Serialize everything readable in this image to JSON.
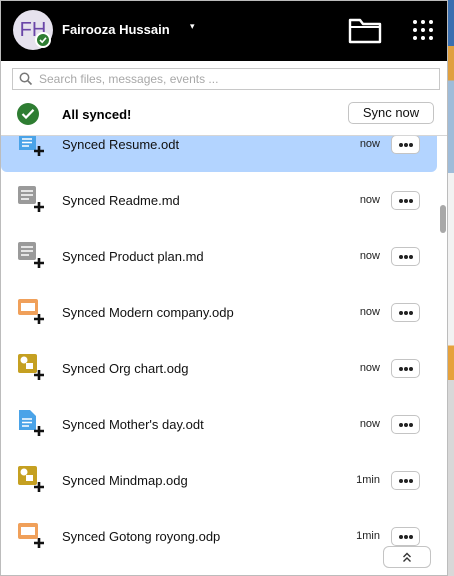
{
  "header": {
    "avatar_initials": "FH",
    "user_name": "Fairooza Hussain",
    "account_menu_caret": "▾",
    "icons": [
      "folder-icon",
      "apps-grid-icon"
    ]
  },
  "search": {
    "placeholder": "Search files, messages, events ..."
  },
  "sync": {
    "status": "All synced!",
    "button_label": "Sync now"
  },
  "activity": [
    {
      "name": "Synced Resume.odt",
      "time": "now",
      "icon": "document-icon",
      "color": "#4aa3e8",
      "selected": true
    },
    {
      "name": "Synced Readme.md",
      "time": "now",
      "icon": "text-file-icon",
      "color": "#9a9a9a"
    },
    {
      "name": "Synced Product plan.md",
      "time": "now",
      "icon": "text-file-icon",
      "color": "#9a9a9a"
    },
    {
      "name": "Synced Modern company.odp",
      "time": "now",
      "icon": "presentation-icon",
      "color": "#f0a05a"
    },
    {
      "name": "Synced Org chart.odg",
      "time": "now",
      "icon": "drawing-icon",
      "color": "#c5a021"
    },
    {
      "name": "Synced Mother's day.odt",
      "time": "now",
      "icon": "document-icon",
      "color": "#4aa3e8"
    },
    {
      "name": "Synced Mindmap.odg",
      "time": "1min",
      "icon": "drawing-icon",
      "color": "#c5a021"
    },
    {
      "name": "Synced Gotong royong.odp",
      "time": "1min",
      "icon": "presentation-icon",
      "color": "#f0a05a"
    }
  ],
  "colors": {
    "header_bg": "#000000",
    "selected_row": "#b3d4ff",
    "sync_ok": "#2e7d32",
    "avatar_text": "#6a46a8"
  }
}
